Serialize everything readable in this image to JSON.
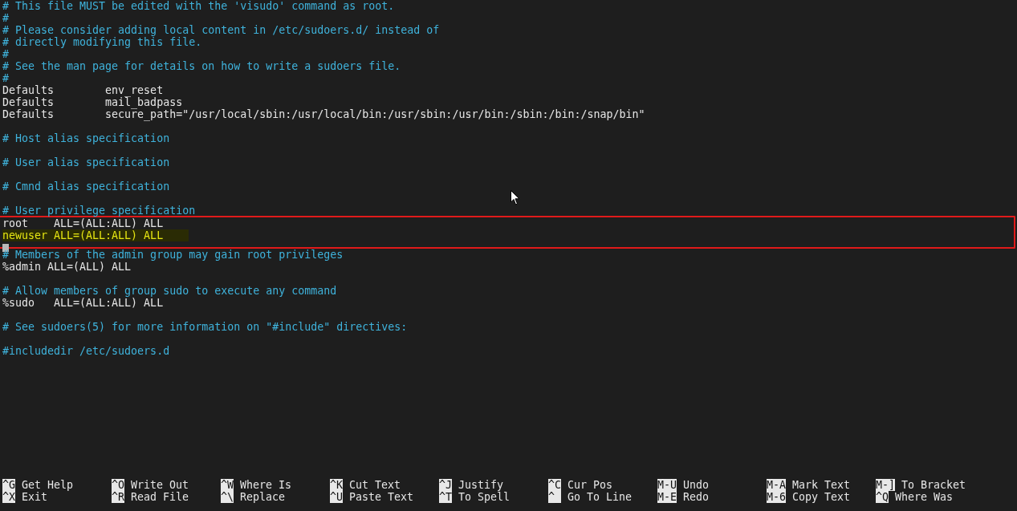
{
  "editor": {
    "lines": [
      {
        "kind": "comment",
        "text": "# This file MUST be edited with the 'visudo' command as root."
      },
      {
        "kind": "comment",
        "text": "#"
      },
      {
        "kind": "comment",
        "text": "# Please consider adding local content in /etc/sudoers.d/ instead of"
      },
      {
        "kind": "comment",
        "text": "# directly modifying this file."
      },
      {
        "kind": "comment",
        "text": "#"
      },
      {
        "kind": "comment",
        "text": "# See the man page for details on how to write a sudoers file."
      },
      {
        "kind": "comment",
        "text": "#"
      },
      {
        "kind": "code",
        "text": "Defaults        env_reset"
      },
      {
        "kind": "code",
        "text": "Defaults        mail_badpass"
      },
      {
        "kind": "code",
        "text": "Defaults        secure_path=\"/usr/local/sbin:/usr/local/bin:/usr/sbin:/usr/bin:/sbin:/bin:/snap/bin\""
      },
      {
        "kind": "blank"
      },
      {
        "kind": "comment",
        "text": "# Host alias specification"
      },
      {
        "kind": "blank"
      },
      {
        "kind": "comment",
        "text": "# User alias specification"
      },
      {
        "kind": "blank"
      },
      {
        "kind": "comment",
        "text": "# Cmnd alias specification"
      },
      {
        "kind": "blank"
      },
      {
        "kind": "comment",
        "text": "# User privilege specification"
      },
      {
        "kind": "group",
        "children": [
          {
            "kind": "code",
            "text": "root    ALL=(ALL:ALL) ALL"
          },
          {
            "kind": "highlighted",
            "text": "newuser ALL=(ALL:ALL) ALL"
          },
          {
            "kind": "cursor"
          }
        ]
      },
      {
        "kind": "comment",
        "text": "# Members of the admin group may gain root privileges"
      },
      {
        "kind": "code",
        "text": "%admin ALL=(ALL) ALL"
      },
      {
        "kind": "blank"
      },
      {
        "kind": "comment",
        "text": "# Allow members of group sudo to execute any command"
      },
      {
        "kind": "code",
        "text": "%sudo   ALL=(ALL:ALL) ALL"
      },
      {
        "kind": "blank"
      },
      {
        "kind": "comment",
        "text": "# See sudoers(5) for more information on \"#include\" directives:"
      },
      {
        "kind": "blank"
      },
      {
        "kind": "comment",
        "text": "#includedir /etc/sudoers.d"
      }
    ]
  },
  "shortcuts": [
    [
      {
        "key": "^G",
        "label": "Get Help"
      },
      {
        "key": "^O",
        "label": "Write Out"
      },
      {
        "key": "^W",
        "label": "Where Is"
      },
      {
        "key": "^K",
        "label": "Cut Text"
      },
      {
        "key": "^J",
        "label": "Justify"
      },
      {
        "key": "^C",
        "label": "Cur Pos"
      },
      {
        "key": "M-U",
        "label": "Undo"
      },
      {
        "key": "M-A",
        "label": "Mark Text"
      },
      {
        "key": "M-]",
        "label": "To Bracket"
      }
    ],
    [
      {
        "key": "^X",
        "label": "Exit"
      },
      {
        "key": "^R",
        "label": "Read File"
      },
      {
        "key": "^\\",
        "label": "Replace"
      },
      {
        "key": "^U",
        "label": "Paste Text"
      },
      {
        "key": "^T",
        "label": "To Spell"
      },
      {
        "key": "^_",
        "label": "Go To Line"
      },
      {
        "key": "M-E",
        "label": "Redo"
      },
      {
        "key": "M-6",
        "label": "Copy Text"
      },
      {
        "key": "^Q",
        "label": "Where Was"
      }
    ]
  ]
}
